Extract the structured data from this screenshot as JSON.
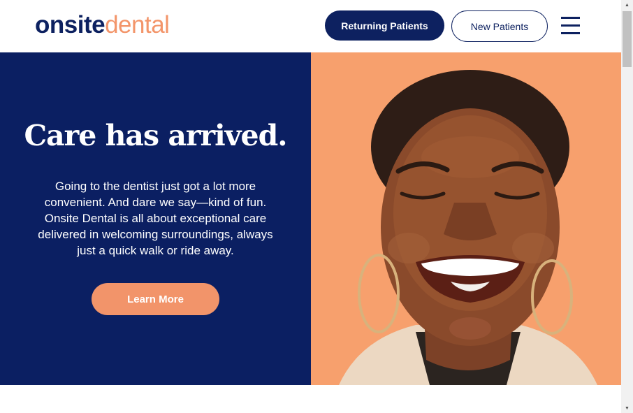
{
  "logo": {
    "part1": "onsite",
    "part2": "dental"
  },
  "header": {
    "returning_label": "Returning Patients",
    "new_label": "New Patients",
    "menu_icon": "hamburger-menu-icon"
  },
  "hero": {
    "title": "Care has arrived.",
    "description": "Going to the dentist just got a lot more convenient. And dare we say—kind of fun. Onsite Dental is all about exceptional care delivered in welcoming surroundings, always just a quick walk or ride away.",
    "cta_label": "Learn More"
  },
  "colors": {
    "navy": "#0b1f62",
    "accent_orange": "#f2946a",
    "image_background": "#f7a06d"
  },
  "scrollbar": {
    "up_icon": "scroll-up-arrow-icon",
    "down_icon": "scroll-down-arrow-icon"
  }
}
